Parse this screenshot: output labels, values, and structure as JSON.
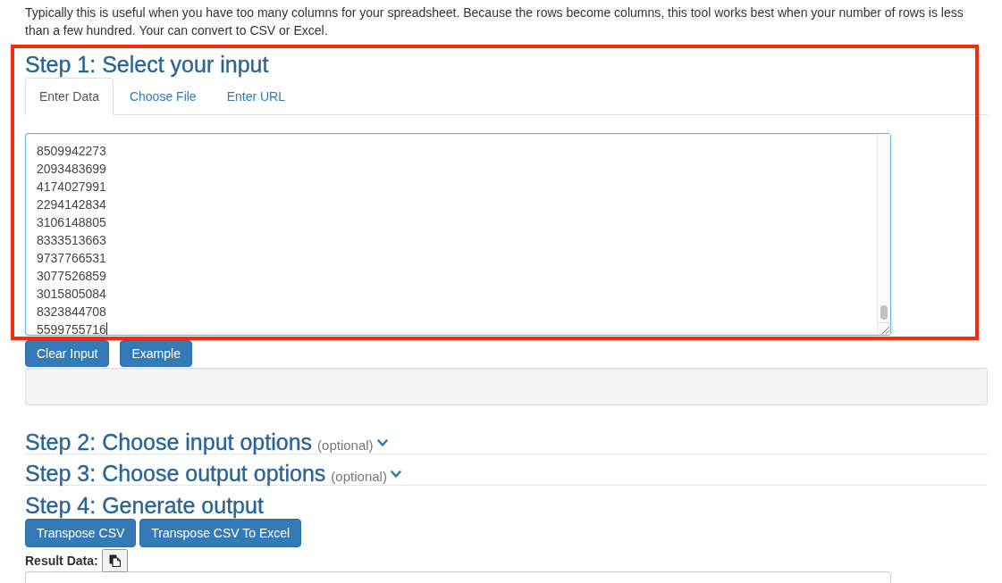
{
  "intro": "Typically this is useful when you have too many columns for your spreadsheet. Because the rows become columns, this tool works best when your number of rows is less than a few hundred. Your can convert to CSV or Excel.",
  "steps": [
    {
      "kind": "input",
      "title": "Step 1: Select your input",
      "highlighted": true,
      "tabs": [
        {
          "label": "Enter Data",
          "selected": true
        },
        {
          "label": "Choose File",
          "selected": false
        },
        {
          "label": "Enter URL",
          "selected": false
        }
      ],
      "input": {
        "focused": true,
        "lines": [
          "8509942273",
          "2093483699",
          "4174027991",
          "2294142834",
          "3106148805",
          "8333513663",
          "9737766531",
          "3077526859",
          "3015805084",
          "8323844708",
          "5599755716"
        ]
      },
      "buttons": [
        "Clear Input",
        "Example"
      ]
    },
    {
      "kind": "collapsible",
      "title": "Step 2: Choose input options",
      "note": "(optional)",
      "expanded": false
    },
    {
      "kind": "collapsible",
      "title": "Step 3: Choose output options",
      "note": "(optional)",
      "expanded": false
    },
    {
      "kind": "output",
      "title": "Step 4: Generate output",
      "buttons": [
        "Transpose CSV",
        "Transpose CSV To Excel"
      ],
      "result_label": "Result Data:"
    }
  ]
}
